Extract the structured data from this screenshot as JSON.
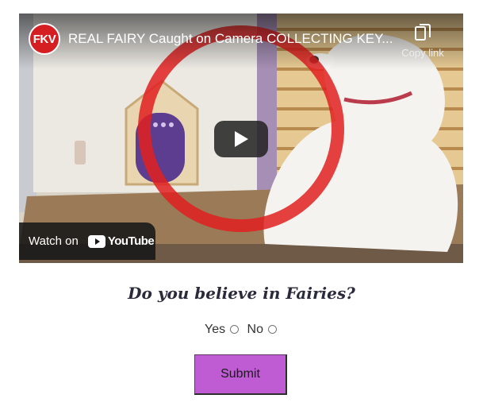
{
  "video": {
    "channel_badge": "FKV",
    "title": "REAL FAIRY Caught on Camera COLLECTING KEY...",
    "copy_link_label": "Copy link",
    "watch_on_label": "Watch on",
    "youtube_wordmark": "YouTube",
    "icons": [
      "copy-icon",
      "play-icon",
      "youtube-icon"
    ]
  },
  "form": {
    "question": "Do you believe in Fairies?",
    "options": [
      {
        "label": "Yes",
        "checked": false
      },
      {
        "label": "No",
        "checked": false
      }
    ],
    "submit_label": "Submit"
  },
  "colors": {
    "submit_bg": "#bf5cd3",
    "channel_badge_bg": "#d51e22",
    "youtube_red": "#ff0000"
  }
}
